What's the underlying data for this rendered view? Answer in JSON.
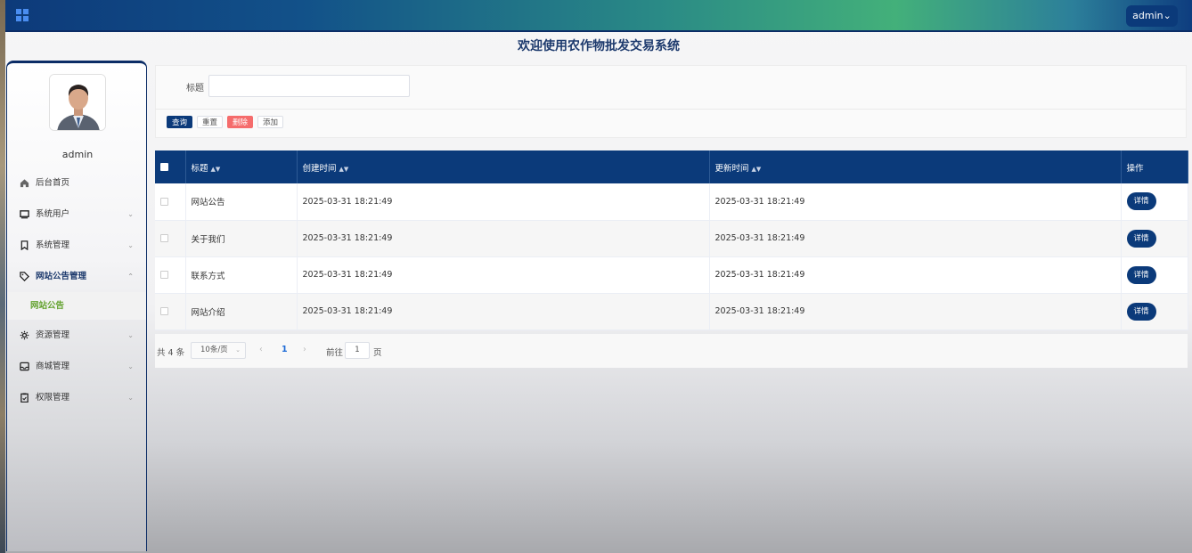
{
  "header": {
    "user_label": "admin"
  },
  "page_title": "欢迎使用农作物批发交易系统",
  "sidebar": {
    "admin_name": "admin",
    "items": [
      {
        "label": "后台首页",
        "icon": "home-icon"
      },
      {
        "label": "系统用户",
        "icon": "monitor-icon"
      },
      {
        "label": "系统管理",
        "icon": "bookmark-icon"
      },
      {
        "label": "网站公告管理",
        "icon": "tag-icon"
      },
      {
        "label": "资源管理",
        "icon": "gear-icon"
      },
      {
        "label": "商城管理",
        "icon": "inbox-icon"
      },
      {
        "label": "权限管理",
        "icon": "clipboard-icon"
      }
    ],
    "submenu_active": "网站公告"
  },
  "search": {
    "label": "标题",
    "value": "",
    "buttons": {
      "query": "查询",
      "reset": "重置",
      "delete": "删除",
      "add": "添加"
    }
  },
  "table": {
    "headers": {
      "title": "标题",
      "created": "创建时间",
      "updated": "更新时间",
      "actions": "操作"
    },
    "rows": [
      {
        "title": "网站公告",
        "created": "2025-03-31 18:21:49",
        "updated": "2025-03-31 18:21:49",
        "action": "详情"
      },
      {
        "title": "关于我们",
        "created": "2025-03-31 18:21:49",
        "updated": "2025-03-31 18:21:49",
        "action": "详情"
      },
      {
        "title": "联系方式",
        "created": "2025-03-31 18:21:49",
        "updated": "2025-03-31 18:21:49",
        "action": "详情"
      },
      {
        "title": "网站介绍",
        "created": "2025-03-31 18:21:49",
        "updated": "2025-03-31 18:21:49",
        "action": "详情"
      }
    ]
  },
  "pagination": {
    "total_label": "共 4 条",
    "page_size": "10条/页",
    "current_page": "1",
    "goto_label": "前往",
    "goto_value": "1",
    "goto_unit": "页"
  },
  "colors": {
    "primary": "#0b3a7a",
    "danger": "#f56c6c",
    "active_submenu": "#63a22f"
  }
}
